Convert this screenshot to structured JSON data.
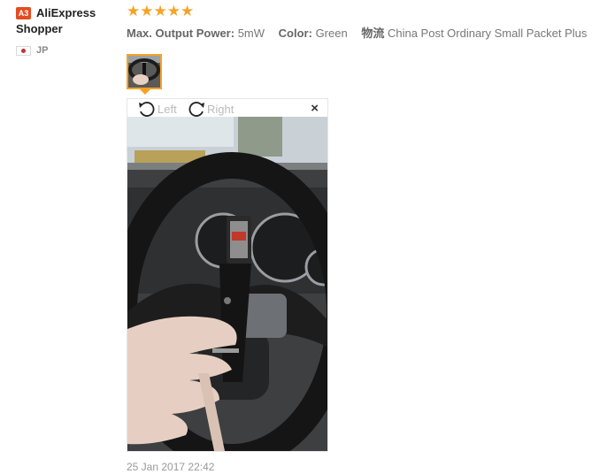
{
  "user": {
    "avatar_text": "A3",
    "name": "AliExpress Shopper",
    "country_code": "JP"
  },
  "review": {
    "stars_text": "★★★★★",
    "rating": 5,
    "properties": [
      {
        "label": "Max. Output Power:",
        "value": "5mW"
      },
      {
        "label": "Color:",
        "value": "Green"
      },
      {
        "label": "物流",
        "value": "China Post Ordinary Small Packet Plus"
      }
    ]
  },
  "viewer": {
    "rotate_left_label": "Left",
    "rotate_right_label": "Right",
    "close_glyph": "×"
  },
  "date": "25 Jan 2017 22:42",
  "colors": {
    "star": "#f7a226",
    "avatar_badge": "#e54b1f",
    "thumb_border": "#f7a226"
  },
  "icons": [
    "rotate-left-icon",
    "rotate-right-icon",
    "close-icon",
    "japan-flag-icon"
  ]
}
